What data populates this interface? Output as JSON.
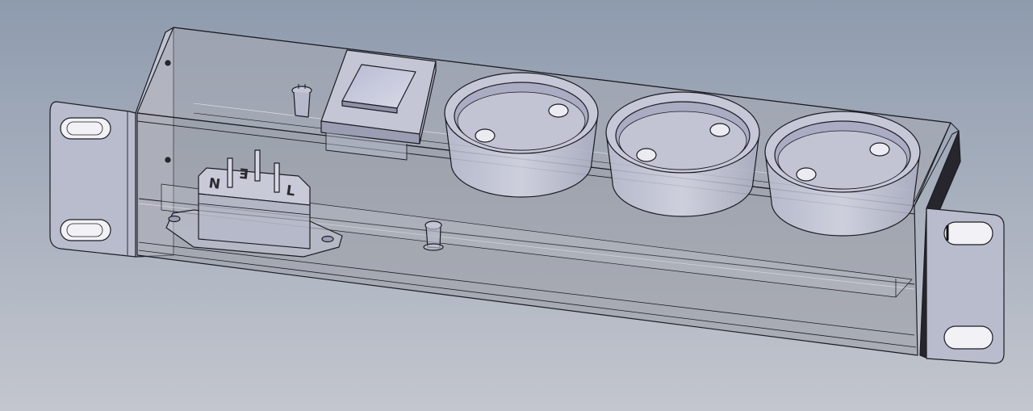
{
  "viewport": {
    "background_top": "#8E9BAE",
    "background_bottom": "#C3C6CE"
  },
  "iec_inlet": {
    "pin_labels": [
      "N",
      "E",
      "L"
    ]
  },
  "outlets": {
    "count": 3
  },
  "colors": {
    "edge": "#1c1c22",
    "housing_fill": "#a6a8b0",
    "housing_front": "#9a9ca4",
    "bracket": "#b9bccd",
    "part_fill": "#c4c6d6",
    "part_dark": "#9b9eb2"
  }
}
